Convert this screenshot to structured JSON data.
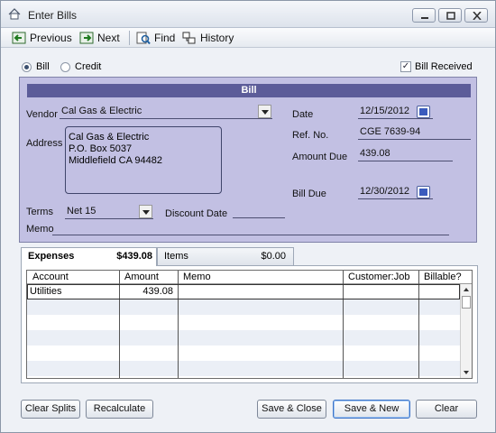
{
  "window": {
    "title": "Enter Bills"
  },
  "toolbar": {
    "previous": "Previous",
    "next": "Next",
    "find": "Find",
    "history": "History"
  },
  "mode": {
    "bill": "Bill",
    "credit": "Credit",
    "selected": "Bill",
    "bill_received_label": "Bill Received",
    "bill_received_checked": true
  },
  "bill": {
    "header": "Bill",
    "vendor_label": "Vendor",
    "vendor": "Cal Gas & Electric",
    "address_label": "Address",
    "address_lines": [
      "Cal Gas & Electric",
      "P.O. Box 5037",
      "Middlefield CA 94482"
    ],
    "date_label": "Date",
    "date": "12/15/2012",
    "ref_label": "Ref. No.",
    "ref": "CGE 7639-94",
    "amount_due_label": "Amount Due",
    "amount_due": "439.08",
    "bill_due_label": "Bill Due",
    "bill_due": "12/30/2012",
    "terms_label": "Terms",
    "terms": "Net 15",
    "discount_date_label": "Discount Date",
    "discount_date": "",
    "memo_label": "Memo",
    "memo": ""
  },
  "tabs": [
    {
      "label": "Expenses",
      "amount": "$439.08",
      "active": true
    },
    {
      "label": "Items",
      "amount": "$0.00",
      "active": false
    }
  ],
  "grid": {
    "columns": [
      "Account",
      "Amount",
      "Memo",
      "Customer:Job",
      "Billable?"
    ],
    "rows": [
      {
        "account": "Utilities",
        "amount": "439.08",
        "memo": "",
        "customer_job": "",
        "billable": ""
      }
    ]
  },
  "buttons": {
    "clear_splits": "Clear Splits",
    "recalculate": "Recalculate",
    "save_close": "Save & Close",
    "save_new": "Save & New",
    "clear": "Clear"
  },
  "colors": {
    "form_bg": "#c2c0e3",
    "form_header": "#5c5c99",
    "grid_alt_row": "#ebeff6"
  }
}
